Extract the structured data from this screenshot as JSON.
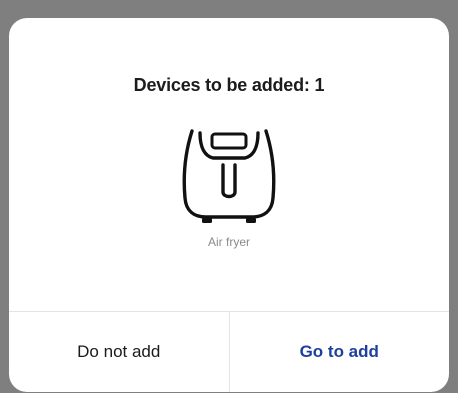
{
  "dialog": {
    "title": "Devices to be added: 1",
    "device": {
      "icon": "air-fryer-icon",
      "label": "Air fryer"
    },
    "buttons": {
      "secondary_label": "Do not add",
      "primary_label": "Go to add"
    }
  },
  "colors": {
    "overlay": "#7f7f7f",
    "dialog_background": "#ffffff",
    "primary_text": "#1f3f9f",
    "muted_text": "#8a8a8a"
  }
}
